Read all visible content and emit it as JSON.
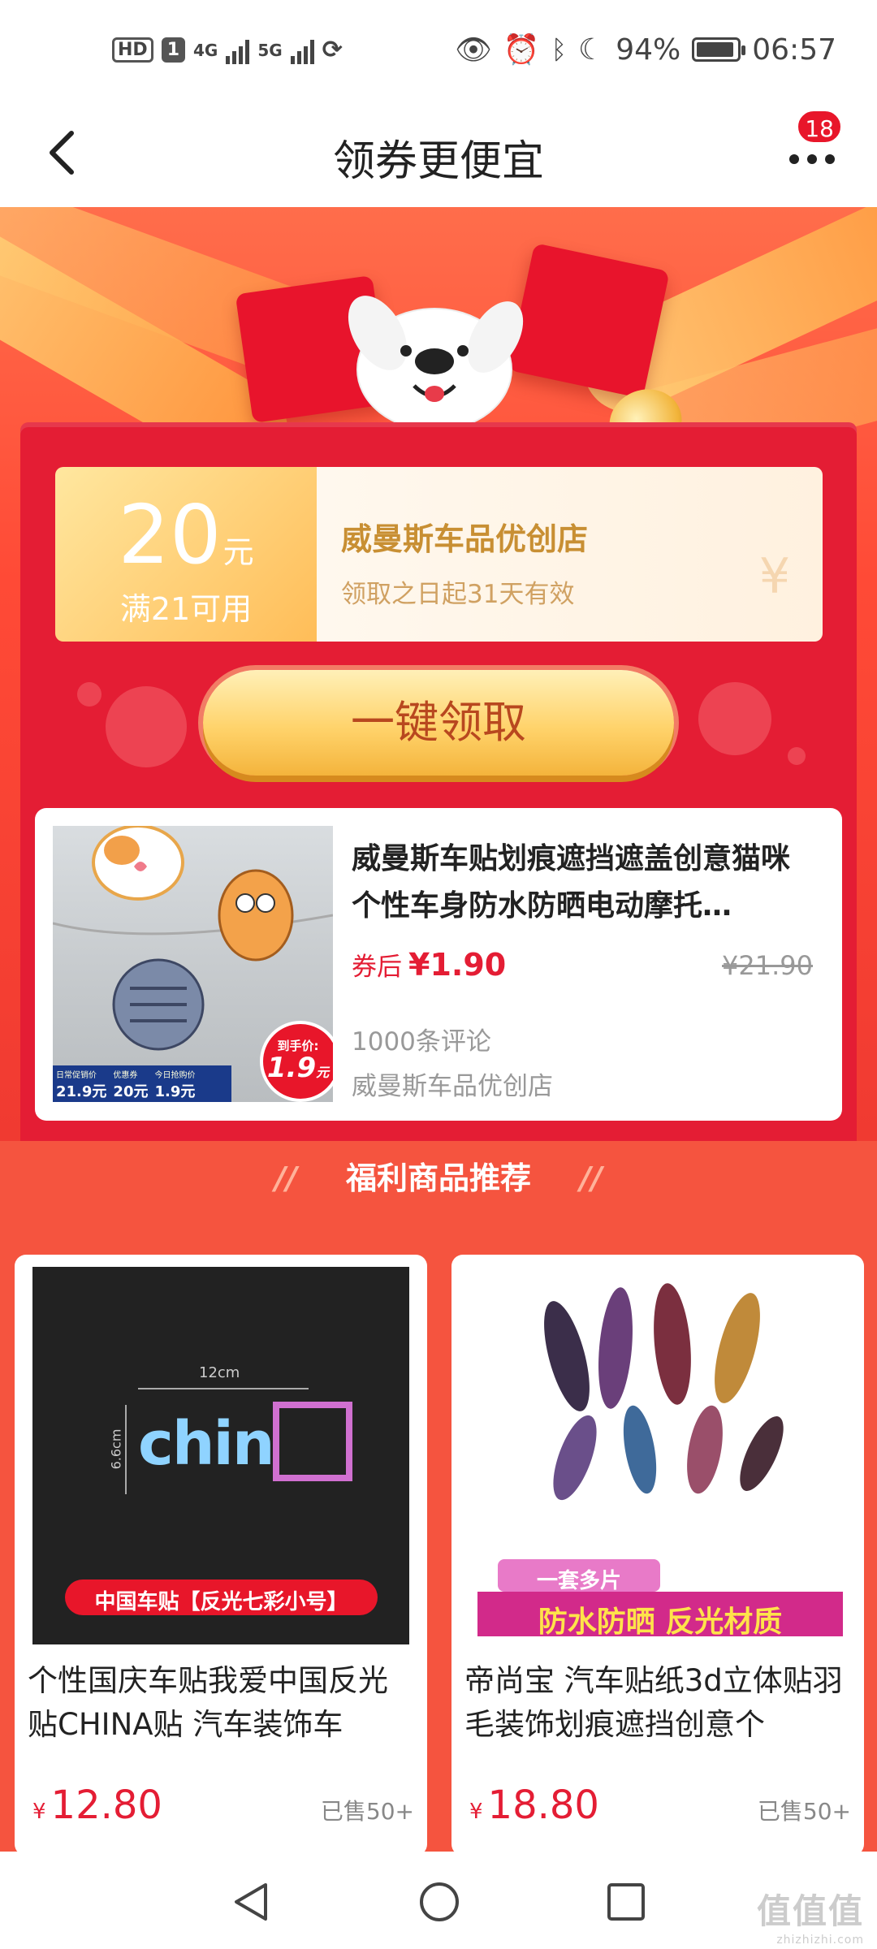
{
  "status_bar": {
    "hd": "HD",
    "sim": "1",
    "net1": "4G",
    "net2": "5G",
    "battery": "94%",
    "battery_level": 0.94,
    "time": "06:57"
  },
  "nav": {
    "back_icon": "chevron-left",
    "title": "领券更便宜",
    "more_icon": "more-dots",
    "badge": "18"
  },
  "coupon": {
    "amount": "20",
    "unit": "元",
    "condition": "满21可用",
    "shop": "威曼斯车品优创店",
    "validity": "领取之日起31天有效"
  },
  "claim_button": "一键领取",
  "product": {
    "name": "威曼斯车贴划痕遮挡遮盖创意猫咪个性车身防水防晒电动摩托…",
    "price_label": "券后",
    "price": "¥1.90",
    "original_price": "¥21.90",
    "reviews": "1000条评论",
    "shop": "威曼斯车品优创店",
    "thumb": {
      "tag": "到手价:",
      "tag_price": "1.9",
      "tag_unit": "元",
      "formula": {
        "label1": "日常促销价",
        "v1": "21.9元",
        "label2": "优惠券",
        "v2": "20元",
        "label3": "今日抢购价",
        "v3": "1.9元"
      }
    }
  },
  "welfare": {
    "title": "福利商品推荐",
    "items": [
      {
        "title": "个性国庆车贴我爱中国反光贴CHINA贴 汽车装饰车",
        "currency": "¥",
        "price": "12.80",
        "sold": "已售50+",
        "img_dim_w": "12cm",
        "img_dim_h": "6.6cm",
        "img_text": "chin",
        "img_banner": "中国车贴【反光七彩小号】"
      },
      {
        "title": "帝尚宝 汽车贴纸3d立体贴羽毛装饰划痕遮挡创意个",
        "currency": "¥",
        "price": "18.80",
        "sold": "已售50+",
        "img_tag": "一套多片",
        "img_banner": "防水防晒 反光材质"
      }
    ]
  },
  "watermark": {
    "text": "值值值",
    "url": "zhizhizhi.com"
  },
  "colors": {
    "accent_red": "#e41d34",
    "page_bg": "#f5543f",
    "gold": "#c88f33"
  }
}
